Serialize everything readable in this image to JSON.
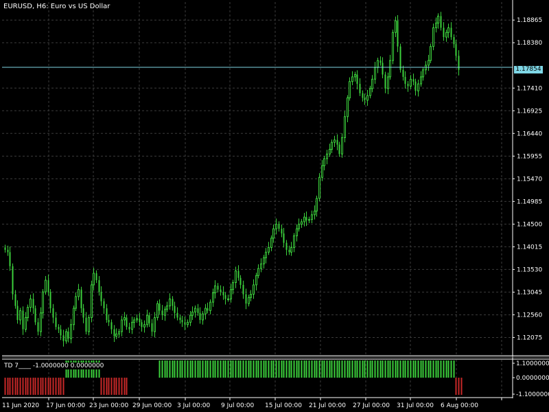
{
  "header": {
    "title": "EURUSD, H6:  Euro vs US Dollar"
  },
  "colors": {
    "background": "#000000",
    "grid": "#3c3c3c",
    "candle": "#3cd13c",
    "current_price_line": "#7fd7e6",
    "histogram_up": "#3cd13c",
    "histogram_down": "#c82828",
    "axis": "#ffffff"
  },
  "price_axis": {
    "labels": [
      "1.18865",
      "1.18380",
      "1.17410",
      "1.16925",
      "1.16440",
      "1.15955",
      "1.15470",
      "1.14985",
      "1.14500",
      "1.14015",
      "1.13530",
      "1.13045",
      "1.12560",
      "1.12075"
    ],
    "current_price": "1.17854"
  },
  "indicator": {
    "title": "TD 7____  -1.0000000 0.0000000",
    "axis_labels": [
      "1.1000000",
      "0.0000000",
      "-1.1000000"
    ]
  },
  "time_axis": {
    "labels": [
      "11 Jun 2020",
      "17 Jun 00:00",
      "23 Jun 00:00",
      "29 Jun 00:00",
      "3 Jul 00:00",
      "9 Jul 00:00",
      "15 Jul 00:00",
      "21 Jul 00:00",
      "27 Jul 00:00",
      "31 Jul 00:00",
      "6 Aug 00:00"
    ]
  },
  "chart_data": {
    "type": "candlestick",
    "symbol": "EURUSD",
    "timeframe": "H6",
    "ylim": [
      1.117,
      1.1925
    ],
    "current_price": 1.17854,
    "closes": [
      1.1395,
      1.139,
      1.136,
      1.13,
      1.1275,
      1.1245,
      1.1265,
      1.1225,
      1.125,
      1.1272,
      1.129,
      1.127,
      1.124,
      1.122,
      1.126,
      1.1305,
      1.133,
      1.1305,
      1.127,
      1.125,
      1.123,
      1.1225,
      1.1212,
      1.12,
      1.122,
      1.1205,
      1.1235,
      1.127,
      1.1295,
      1.131,
      1.127,
      1.125,
      1.122,
      1.125,
      1.132,
      1.1345,
      1.133,
      1.1305,
      1.1285,
      1.127,
      1.1245,
      1.124,
      1.1225,
      1.121,
      1.1215,
      1.122,
      1.1245,
      1.125,
      1.123,
      1.1225,
      1.124,
      1.1245,
      1.1248,
      1.124,
      1.123,
      1.1235,
      1.1255,
      1.1238,
      1.122,
      1.125,
      1.128,
      1.1265,
      1.1255,
      1.1268,
      1.1275,
      1.129,
      1.1275,
      1.126,
      1.125,
      1.1245,
      1.124,
      1.1235,
      1.124,
      1.1255,
      1.1262,
      1.127,
      1.126,
      1.1245,
      1.1258,
      1.127,
      1.1265,
      1.1283,
      1.1303,
      1.1318,
      1.131,
      1.1305,
      1.1298,
      1.129,
      1.129,
      1.131,
      1.1325,
      1.135,
      1.1335,
      1.132,
      1.13,
      1.128,
      1.1293,
      1.13,
      1.132,
      1.134,
      1.1355,
      1.1365,
      1.1378,
      1.139,
      1.14,
      1.142,
      1.144,
      1.145,
      1.144,
      1.143,
      1.141,
      1.1395,
      1.139,
      1.14,
      1.1425,
      1.144,
      1.145,
      1.1455,
      1.1465,
      1.1458,
      1.146,
      1.147,
      1.1478,
      1.1505,
      1.155,
      1.1575,
      1.159,
      1.16,
      1.161,
      1.1625,
      1.163,
      1.162,
      1.16,
      1.1635,
      1.168,
      1.172,
      1.1755,
      1.1765,
      1.177,
      1.175,
      1.173,
      1.172,
      1.1715,
      1.1725,
      1.174,
      1.176,
      1.1785,
      1.18,
      1.1795,
      1.177,
      1.174,
      1.1765,
      1.18,
      1.186,
      1.1885,
      1.183,
      1.178,
      1.1765,
      1.175,
      1.1745,
      1.176,
      1.1755,
      1.1735,
      1.175,
      1.1765,
      1.178,
      1.179,
      1.18,
      1.183,
      1.187,
      1.188,
      1.1895,
      1.187,
      1.185,
      1.186,
      1.187,
      1.185,
      1.1835,
      1.181,
      1.178
    ],
    "indicator_values": [
      -1,
      -1,
      -1,
      -1,
      -1,
      -1,
      -1,
      -1,
      -1,
      -1,
      -1,
      -1,
      -1,
      -1,
      -1,
      -1,
      -1,
      -1,
      -1,
      -1,
      -1,
      -1,
      -1,
      -1,
      1,
      1,
      1,
      1,
      1,
      1,
      1,
      1,
      1,
      1,
      1,
      1,
      1,
      1,
      -1,
      -1,
      -1,
      -1,
      -1,
      -1,
      -1,
      -1,
      -1,
      -1,
      -1,
      0,
      0,
      0,
      0,
      0,
      0,
      0,
      0,
      0,
      0,
      0,
      0,
      1,
      1,
      1,
      1,
      1,
      1,
      1,
      1,
      1,
      1,
      1,
      1,
      1,
      1,
      1,
      1,
      1,
      1,
      1,
      1,
      1,
      1,
      1,
      1,
      1,
      1,
      1,
      1,
      1,
      1,
      1,
      1,
      1,
      1,
      1,
      1,
      1,
      1,
      1,
      1,
      1,
      1,
      1,
      1,
      1,
      1,
      1,
      1,
      1,
      1,
      1,
      1,
      1,
      1,
      1,
      1,
      1,
      1,
      1,
      1,
      1,
      1,
      1,
      1,
      1,
      1,
      1,
      1,
      1,
      1,
      1,
      1,
      1,
      1,
      1,
      1,
      1,
      1,
      1,
      1,
      1,
      1,
      1,
      1,
      1,
      1,
      1,
      1,
      1,
      1,
      1,
      1,
      1,
      1,
      1,
      1,
      1,
      1,
      1,
      1,
      1,
      1,
      1,
      1,
      1,
      1,
      1,
      1,
      1,
      1,
      1,
      1,
      1,
      1,
      1,
      1,
      1,
      -1,
      -1,
      -1
    ]
  }
}
